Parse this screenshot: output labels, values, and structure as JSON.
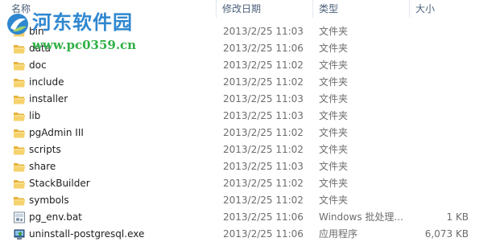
{
  "columns": {
    "name": "名称",
    "date": "修改日期",
    "type": "类型",
    "size": "大小"
  },
  "watermark": {
    "title": "河东软件园",
    "url": "www.pc0359.cn"
  },
  "files": [
    {
      "name": "bin",
      "date": "2013/2/25 11:03",
      "type": "文件夹",
      "size": "",
      "icon": "folder-icon"
    },
    {
      "name": "data",
      "date": "2013/2/25 11:06",
      "type": "文件夹",
      "size": "",
      "icon": "folder-icon"
    },
    {
      "name": "doc",
      "date": "2013/2/25 11:02",
      "type": "文件夹",
      "size": "",
      "icon": "folder-icon"
    },
    {
      "name": "include",
      "date": "2013/2/25 11:02",
      "type": "文件夹",
      "size": "",
      "icon": "folder-icon"
    },
    {
      "name": "installer",
      "date": "2013/2/25 11:03",
      "type": "文件夹",
      "size": "",
      "icon": "folder-icon"
    },
    {
      "name": "lib",
      "date": "2013/2/25 11:03",
      "type": "文件夹",
      "size": "",
      "icon": "folder-icon"
    },
    {
      "name": "pgAdmin III",
      "date": "2013/2/25 11:02",
      "type": "文件夹",
      "size": "",
      "icon": "folder-icon"
    },
    {
      "name": "scripts",
      "date": "2013/2/25 11:02",
      "type": "文件夹",
      "size": "",
      "icon": "folder-icon"
    },
    {
      "name": "share",
      "date": "2013/2/25 11:03",
      "type": "文件夹",
      "size": "",
      "icon": "folder-icon"
    },
    {
      "name": "StackBuilder",
      "date": "2013/2/25 11:02",
      "type": "文件夹",
      "size": "",
      "icon": "folder-icon"
    },
    {
      "name": "symbols",
      "date": "2013/2/25 11:02",
      "type": "文件夹",
      "size": "",
      "icon": "folder-icon"
    },
    {
      "name": "pg_env.bat",
      "date": "2013/2/25 11:06",
      "type": "Windows 批处理...",
      "size": "1 KB",
      "icon": "batch-file-icon"
    },
    {
      "name": "uninstall-postgresql.exe",
      "date": "2013/2/25 11:06",
      "type": "应用程序",
      "size": "6,073 KB",
      "icon": "installer-exe-icon"
    }
  ]
}
